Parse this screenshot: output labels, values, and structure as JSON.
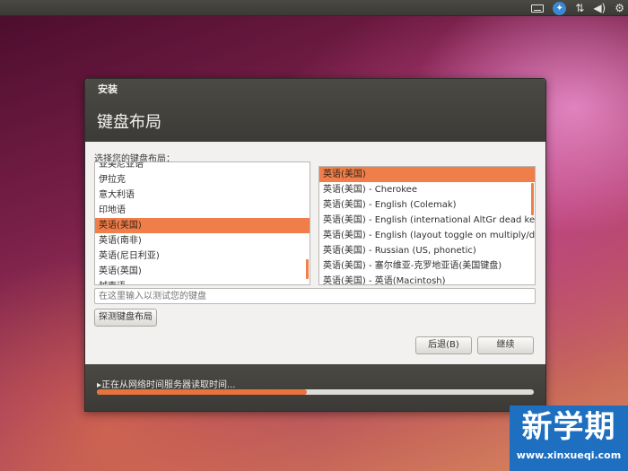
{
  "topbar": {
    "icons": [
      "keyboard-icon",
      "accessibility-icon",
      "network-icon",
      "volume-icon",
      "gear-icon"
    ]
  },
  "window": {
    "title": "安装",
    "heading": "键盘布局",
    "prompt": "选择您的键盘布局：",
    "layouts": [
      {
        "label": "亚美尼亚语",
        "selected": false
      },
      {
        "label": "伊拉克",
        "selected": false
      },
      {
        "label": "意大利语",
        "selected": false
      },
      {
        "label": "印地语",
        "selected": false
      },
      {
        "label": "英语(美国)",
        "selected": true
      },
      {
        "label": "英语(南非)",
        "selected": false
      },
      {
        "label": "英语(尼日利亚)",
        "selected": false
      },
      {
        "label": "英语(英国)",
        "selected": false
      },
      {
        "label": "越南语",
        "selected": false
      }
    ],
    "variants": [
      {
        "label": "英语(美国)",
        "selected": true
      },
      {
        "label": "英语(美国) - Cherokee",
        "selected": false
      },
      {
        "label": "英语(美国) - English (Colemak)",
        "selected": false
      },
      {
        "label": "英语(美国) - English (international AltGr dead keys)",
        "selected": false
      },
      {
        "label": "英语(美国) - English (layout toggle on multiply/divide key)",
        "selected": false
      },
      {
        "label": "英语(美国) - Russian (US, phonetic)",
        "selected": false
      },
      {
        "label": "英语(美国) - 塞尔维亚-克罗地亚语(美国键盘)",
        "selected": false
      },
      {
        "label": "英语(美国) - 英语(Macintosh)",
        "selected": false
      }
    ],
    "test_placeholder": "在这里输入以测试您的键盘",
    "detect_label": "探测键盘布局",
    "back_label": "后退(B)",
    "next_label": "继续",
    "status_text": "正在从网络时间服务器读取时间...",
    "progress": 0.48
  },
  "watermark": {
    "main": "新学期",
    "url": "www.xinxueqi.com"
  },
  "colors": {
    "accent": "#ef7e4a",
    "header": "#3c3b37",
    "watermark": "#1e6fc0"
  }
}
